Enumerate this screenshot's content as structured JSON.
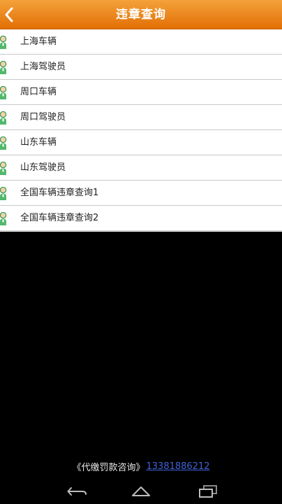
{
  "header": {
    "title": "违章查询"
  },
  "list": {
    "items": [
      {
        "label": "上海车辆"
      },
      {
        "label": "上海驾驶员"
      },
      {
        "label": "周口车辆"
      },
      {
        "label": "周口驾驶员"
      },
      {
        "label": "山东车辆"
      },
      {
        "label": "山东驾驶员"
      },
      {
        "label": "全国车辆违章查询1"
      },
      {
        "label": "全国车辆违章查询2"
      }
    ]
  },
  "footer": {
    "label": "《代缴罚款咨询》",
    "phone": "13381886212"
  },
  "theme": {
    "header_color": "#e67a12",
    "link_color": "#3f63d8"
  }
}
